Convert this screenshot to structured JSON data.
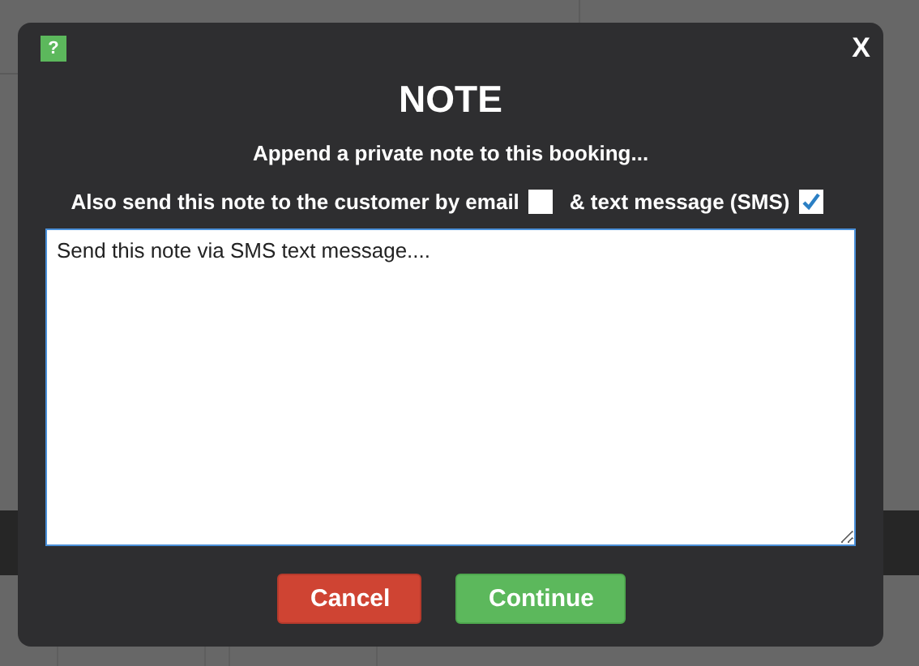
{
  "dialog": {
    "help": "?",
    "close": "X",
    "title": "NOTE",
    "subtitle": "Append a private note to this booking...",
    "options": [
      {
        "label": "Also send this note to the customer by email",
        "checked": false
      },
      {
        "label": "& text message (SMS)",
        "checked": true
      }
    ],
    "note": {
      "value": "Send this note via SMS text message...."
    },
    "buttons": [
      {
        "kind": "cancel",
        "label": "Cancel"
      },
      {
        "kind": "continue",
        "label": "Continue"
      }
    ]
  }
}
